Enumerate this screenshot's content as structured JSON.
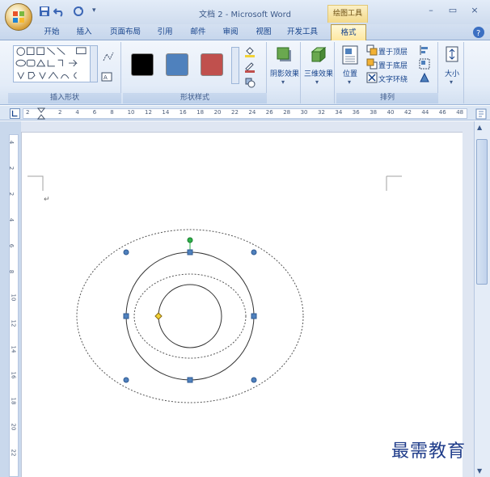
{
  "titlebar": {
    "doc_title": "文档 2 - Microsoft Word",
    "context_group": "绘图工具",
    "minimize": "–",
    "restore": "▭",
    "close": "×"
  },
  "tabs": [
    "开始",
    "插入",
    "页面布局",
    "引用",
    "邮件",
    "审阅",
    "视图",
    "开发工具"
  ],
  "active_tab": "格式",
  "ribbon": {
    "insert_shapes_label": "插入形状",
    "shape_styles_label": "形状样式",
    "shadow_label": "阴影效果",
    "threed_label": "三维效果",
    "arrange_label": "排列",
    "position_label": "位置",
    "bring_front": "置于顶层",
    "send_back": "置于底层",
    "text_wrap": "文字环绕",
    "size_label": "大小",
    "swatch_colors": [
      "#000000",
      "#4f81bd",
      "#c0504d"
    ]
  },
  "ruler": {
    "h_numbers": [
      "2",
      "2",
      "4",
      "6",
      "8",
      "10",
      "12",
      "14",
      "16",
      "18",
      "20",
      "22",
      "24",
      "26",
      "28",
      "30",
      "32",
      "34",
      "36",
      "38",
      "40",
      "42",
      "44",
      "46",
      "48"
    ],
    "v_numbers": [
      "4",
      "2",
      "2",
      "4",
      "6",
      "8",
      "10",
      "12",
      "14",
      "16",
      "18",
      "20",
      "22"
    ]
  },
  "watermark": "最需教育",
  "colors": {
    "accent": "#15428b",
    "handle": "#4f81bd",
    "rotate_handle": "#2db34a",
    "adjust_handle": "#f2d235"
  }
}
